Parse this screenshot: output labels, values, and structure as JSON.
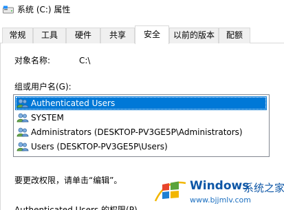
{
  "window": {
    "title": "系统 (C:) 属性",
    "icon": "drive-icon"
  },
  "tabs": [
    {
      "label": "常规",
      "active": false
    },
    {
      "label": "工具",
      "active": false
    },
    {
      "label": "硬件",
      "active": false
    },
    {
      "label": "共享",
      "active": false
    },
    {
      "label": "安全",
      "active": true
    },
    {
      "label": "以前的版本",
      "active": false
    },
    {
      "label": "配额",
      "active": false
    }
  ],
  "security": {
    "object_name_label": "对象名称:",
    "object_name_value": "C:\\",
    "group_label": "组或用户名(G):",
    "users": [
      {
        "name": "Authenticated Users",
        "selected": true,
        "icon": "users-group-icon"
      },
      {
        "name": "SYSTEM",
        "selected": false,
        "icon": "users-group-icon"
      },
      {
        "name": "Administrators (DESKTOP-PV3GE5P\\Administrators)",
        "selected": false,
        "icon": "users-group-icon"
      },
      {
        "name": "Users (DESKTOP-PV3GE5P\\Users)",
        "selected": false,
        "icon": "users-group-icon"
      }
    ],
    "edit_hint": "要更改权限，请单击“编辑”。",
    "permissions_label": "Authenticated Users 的权限(P)"
  },
  "watermark": {
    "brand": "Windows",
    "cn_text": "系统之家",
    "url": "www.bjjmlv.com"
  },
  "colors": {
    "selection": "#0078d7",
    "watermark_blue": "#0d56a6"
  }
}
